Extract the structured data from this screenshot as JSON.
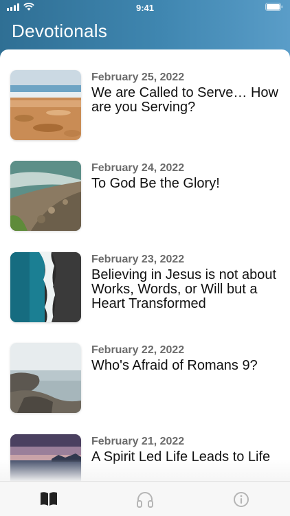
{
  "status_bar": {
    "time": "9:41"
  },
  "header": {
    "title": "Devotionals"
  },
  "devotionals": [
    {
      "date": "February 25, 2022",
      "title": "We are Called to Serve… How are you Serving?",
      "image": "beach-sand-waves"
    },
    {
      "date": "February 24, 2022",
      "title": "To God Be the Glory!",
      "image": "rocky-shore-aerial"
    },
    {
      "date": "February 23, 2022",
      "title": "Believing in Jesus is not about Works, Words, or Will but a Heart Transformed",
      "image": "ocean-meets-black-sand"
    },
    {
      "date": "February 22, 2022",
      "title": "Who's Afraid of Romans 9?",
      "image": "coastal-rocks-sea"
    },
    {
      "date": "February 21, 2022",
      "title": "A Spirit Led Life Leads to Life",
      "image": "sunset-sea"
    }
  ],
  "tab_bar": {
    "tabs": [
      {
        "name": "book-icon",
        "active": true
      },
      {
        "name": "headphones-icon",
        "active": false
      },
      {
        "name": "info-icon",
        "active": false
      }
    ]
  },
  "colors": {
    "header_gradient_start": "#2f6f94",
    "header_gradient_end": "#5a9dc8",
    "title_text": "#111111",
    "date_text": "#6b6b6b",
    "tab_active": "#222222",
    "tab_inactive": "#b5b5b5"
  }
}
